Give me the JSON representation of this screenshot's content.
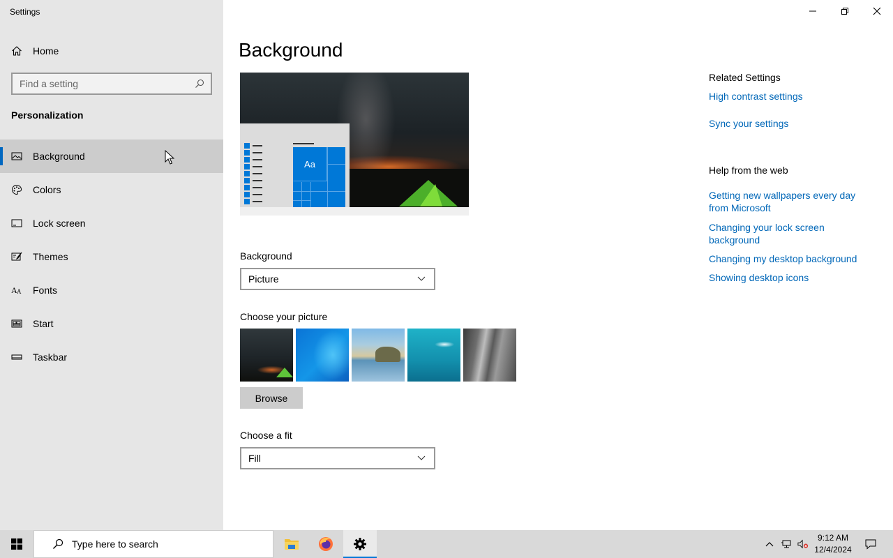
{
  "window": {
    "title": "Settings"
  },
  "sidebar": {
    "home_label": "Home",
    "search_placeholder": "Find a setting",
    "section_title": "Personalization",
    "items": [
      {
        "label": "Background",
        "icon": "picture-icon",
        "active": true
      },
      {
        "label": "Colors",
        "icon": "palette-icon",
        "active": false
      },
      {
        "label": "Lock screen",
        "icon": "lock-screen-icon",
        "active": false
      },
      {
        "label": "Themes",
        "icon": "themes-icon",
        "active": false
      },
      {
        "label": "Fonts",
        "icon": "fonts-icon",
        "active": false
      },
      {
        "label": "Start",
        "icon": "start-icon",
        "active": false
      },
      {
        "label": "Taskbar",
        "icon": "taskbar-icon",
        "active": false
      }
    ]
  },
  "main": {
    "page_title": "Background",
    "preview": {
      "sample_text": "Aa"
    },
    "background_label": "Background",
    "background_value": "Picture",
    "choose_picture_label": "Choose your picture",
    "browse_label": "Browse",
    "fit_label": "Choose a fit",
    "fit_value": "Fill"
  },
  "related": {
    "heading": "Related Settings",
    "links": [
      "High contrast settings",
      "Sync your settings"
    ],
    "help_heading": "Help from the web",
    "help_links": [
      "Getting new wallpapers every day from Microsoft",
      "Changing your lock screen background",
      "Changing my desktop background",
      "Showing desktop icons"
    ]
  },
  "taskbar": {
    "search_placeholder": "Type here to search",
    "time": "9:12 AM",
    "date": "12/4/2024"
  },
  "colors": {
    "accent": "#0078d7",
    "link": "#0067b8",
    "sidebar_bg": "#e6e6e6",
    "active_item_bg": "#cccccc",
    "taskbar_bg": "#d9d9d9"
  }
}
